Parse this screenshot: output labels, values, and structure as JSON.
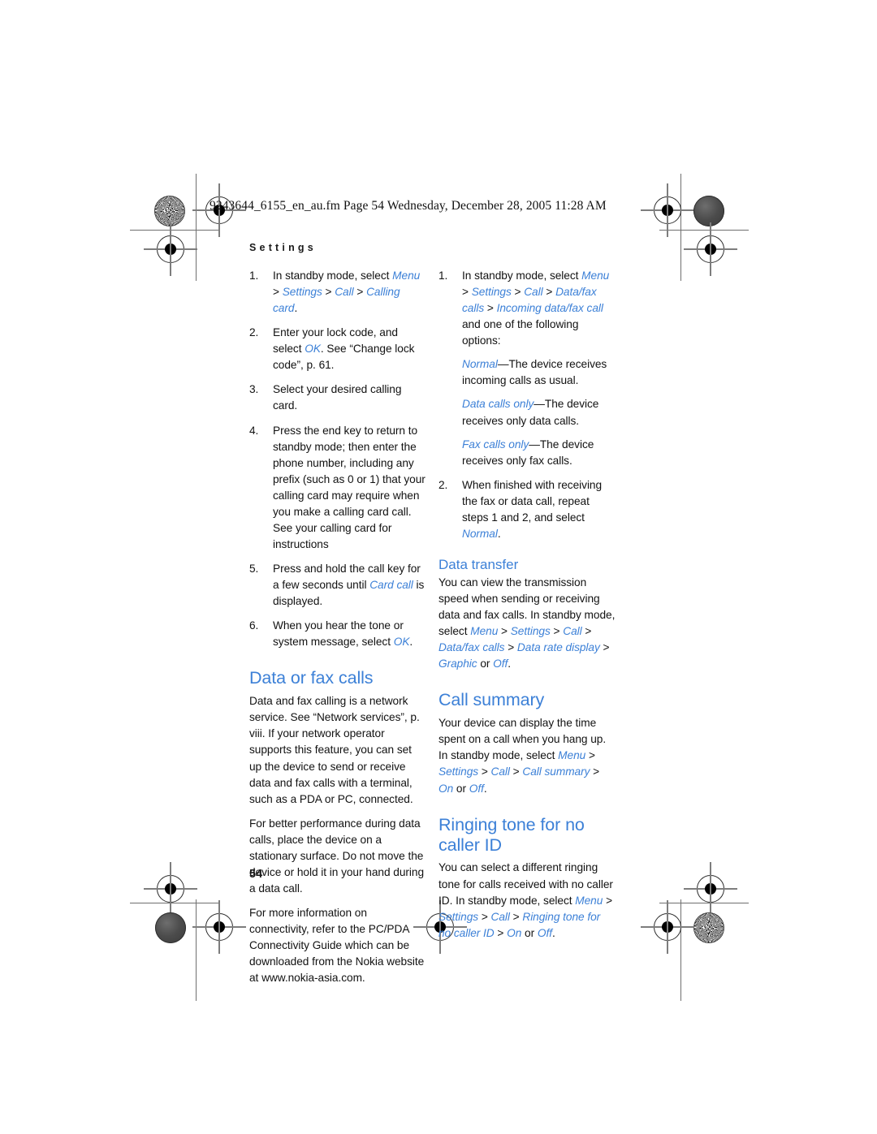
{
  "page": {
    "filename_line": "9243644_6155_en_au.fm  Page 54  Wednesday, December 28, 2005  11:28 AM",
    "running_head": "Settings",
    "folio": "54",
    "accent_color": "#3c80d7",
    "text_color": "#121212"
  },
  "marks": {
    "rosette_icon": "rosette-registration-icon",
    "blob_icon": "solid-dot-registration-icon",
    "crosshair_icon": "crosshair-registration-icon"
  },
  "left_column": {
    "steps_calling_card": [
      {
        "num": "1.",
        "parts": [
          {
            "t": "In standby mode, select ",
            "s": "plain"
          },
          {
            "t": "Menu",
            "s": "ui"
          },
          {
            "t": " > ",
            "s": "plain"
          },
          {
            "t": "Settings",
            "s": "ui"
          },
          {
            "t": " > ",
            "s": "plain"
          },
          {
            "t": "Call",
            "s": "ui"
          },
          {
            "t": " > ",
            "s": "plain"
          },
          {
            "t": "Calling card",
            "s": "ui"
          },
          {
            "t": ".",
            "s": "plain"
          }
        ]
      },
      {
        "num": "2.",
        "parts": [
          {
            "t": "Enter your lock code, and select ",
            "s": "plain"
          },
          {
            "t": "OK",
            "s": "ui"
          },
          {
            "t": ". See “Change lock code”, p. 61.",
            "s": "plain"
          }
        ]
      },
      {
        "num": "3.",
        "parts": [
          {
            "t": "Select your desired calling card.",
            "s": "plain"
          }
        ]
      },
      {
        "num": "4.",
        "parts": [
          {
            "t": "Press the end key to return to standby mode; then enter the phone number, including any prefix (such as 0 or 1) that your calling card may require when you make a calling card call. See your calling card for instructions",
            "s": "plain"
          }
        ]
      },
      {
        "num": "5.",
        "parts": [
          {
            "t": "Press and hold the call key for a few seconds until ",
            "s": "plain"
          },
          {
            "t": "Card call",
            "s": "ui"
          },
          {
            "t": " is displayed.",
            "s": "plain"
          }
        ]
      },
      {
        "num": "6.",
        "parts": [
          {
            "t": "When you hear the tone or system message, select ",
            "s": "plain"
          },
          {
            "t": "OK",
            "s": "ui"
          },
          {
            "t": ".",
            "s": "plain"
          }
        ]
      }
    ],
    "heading_data_or_fax_calls": "Data or fax calls",
    "paragraphs": [
      "Data and fax calling is a network service. See “Network services”, p. viii. If your network operator supports this feature, you can set up the device to send or receive data and fax calls with a terminal, such as a PDA or PC, connected.",
      "For better performance during data calls, place the device on a stationary surface. Do not move the device or hold it in your hand during a data call.",
      "For more information on connectivity, refer to the PC/PDA Connectivity Guide which can be downloaded from the Nokia website at www.nokia-asia.com."
    ]
  },
  "right_column": {
    "steps_data_fax": [
      {
        "num": "1.",
        "parts": [
          {
            "t": "In standby mode, select ",
            "s": "plain"
          },
          {
            "t": "Menu",
            "s": "ui"
          },
          {
            "t": " > ",
            "s": "plain"
          },
          {
            "t": "Settings",
            "s": "ui"
          },
          {
            "t": " > ",
            "s": "plain"
          },
          {
            "t": "Call",
            "s": "ui"
          },
          {
            "t": " > ",
            "s": "plain"
          },
          {
            "t": "Data/fax calls",
            "s": "ui"
          },
          {
            "t": " > ",
            "s": "plain"
          },
          {
            "t": "Incoming data/fax call",
            "s": "ui"
          },
          {
            "t": " and one of the following options:",
            "s": "plain"
          }
        ],
        "options": [
          [
            {
              "t": "Normal",
              "s": "ui"
            },
            {
              "t": "—The device receives incoming calls as usual.",
              "s": "plain"
            }
          ],
          [
            {
              "t": "Data calls only",
              "s": "ui"
            },
            {
              "t": "—The device receives only data calls.",
              "s": "plain"
            }
          ],
          [
            {
              "t": "Fax calls only",
              "s": "ui"
            },
            {
              "t": "—The device receives only fax calls.",
              "s": "plain"
            }
          ]
        ]
      },
      {
        "num": "2.",
        "parts": [
          {
            "t": "When finished with receiving the fax or data call, repeat steps 1 and 2, and select ",
            "s": "plain"
          },
          {
            "t": "Normal",
            "s": "ui"
          },
          {
            "t": ".",
            "s": "plain"
          }
        ],
        "options": []
      }
    ],
    "heading_data_transfer": "Data transfer",
    "para_data_transfer": [
      {
        "t": "You can view the transmission speed when sending or receiving data and fax calls. In standby mode, select ",
        "s": "plain"
      },
      {
        "t": "Menu",
        "s": "ui"
      },
      {
        "t": " > ",
        "s": "plain"
      },
      {
        "t": "Settings",
        "s": "ui"
      },
      {
        "t": " > ",
        "s": "plain"
      },
      {
        "t": "Call",
        "s": "ui"
      },
      {
        "t": " > ",
        "s": "plain"
      },
      {
        "t": "Data/fax calls",
        "s": "ui"
      },
      {
        "t": " > ",
        "s": "plain"
      },
      {
        "t": "Data rate display",
        "s": "ui"
      },
      {
        "t": " > ",
        "s": "plain"
      },
      {
        "t": "Graphic",
        "s": "ui"
      },
      {
        "t": " or ",
        "s": "plain"
      },
      {
        "t": "Off",
        "s": "ui"
      },
      {
        "t": ".",
        "s": "plain"
      }
    ],
    "heading_call_summary": "Call summary",
    "para_call_summary": [
      {
        "t": "Your device can display the time spent on a call when you hang up. In standby mode, select ",
        "s": "plain"
      },
      {
        "t": "Menu",
        "s": "ui"
      },
      {
        "t": " > ",
        "s": "plain"
      },
      {
        "t": "Settings",
        "s": "ui"
      },
      {
        "t": " > ",
        "s": "plain"
      },
      {
        "t": "Call",
        "s": "ui"
      },
      {
        "t": " > ",
        "s": "plain"
      },
      {
        "t": "Call summary",
        "s": "ui"
      },
      {
        "t": " > ",
        "s": "plain"
      },
      {
        "t": "On",
        "s": "ui"
      },
      {
        "t": " or ",
        "s": "plain"
      },
      {
        "t": "Off",
        "s": "ui"
      },
      {
        "t": ".",
        "s": "plain"
      }
    ],
    "heading_ringing_tone": "Ringing tone for no caller ID",
    "para_ringing_tone": [
      {
        "t": "You can select a different ringing tone for calls received with no caller ID. In standby mode, select ",
        "s": "plain"
      },
      {
        "t": "Menu",
        "s": "ui"
      },
      {
        "t": " > ",
        "s": "plain"
      },
      {
        "t": "Settings",
        "s": "ui"
      },
      {
        "t": " > ",
        "s": "plain"
      },
      {
        "t": "Call",
        "s": "ui"
      },
      {
        "t": " > ",
        "s": "plain"
      },
      {
        "t": "Ringing tone for no caller ID",
        "s": "ui"
      },
      {
        "t": " > ",
        "s": "plain"
      },
      {
        "t": "On",
        "s": "ui"
      },
      {
        "t": " or ",
        "s": "plain"
      },
      {
        "t": "Off",
        "s": "ui"
      },
      {
        "t": ".",
        "s": "plain"
      }
    ]
  }
}
